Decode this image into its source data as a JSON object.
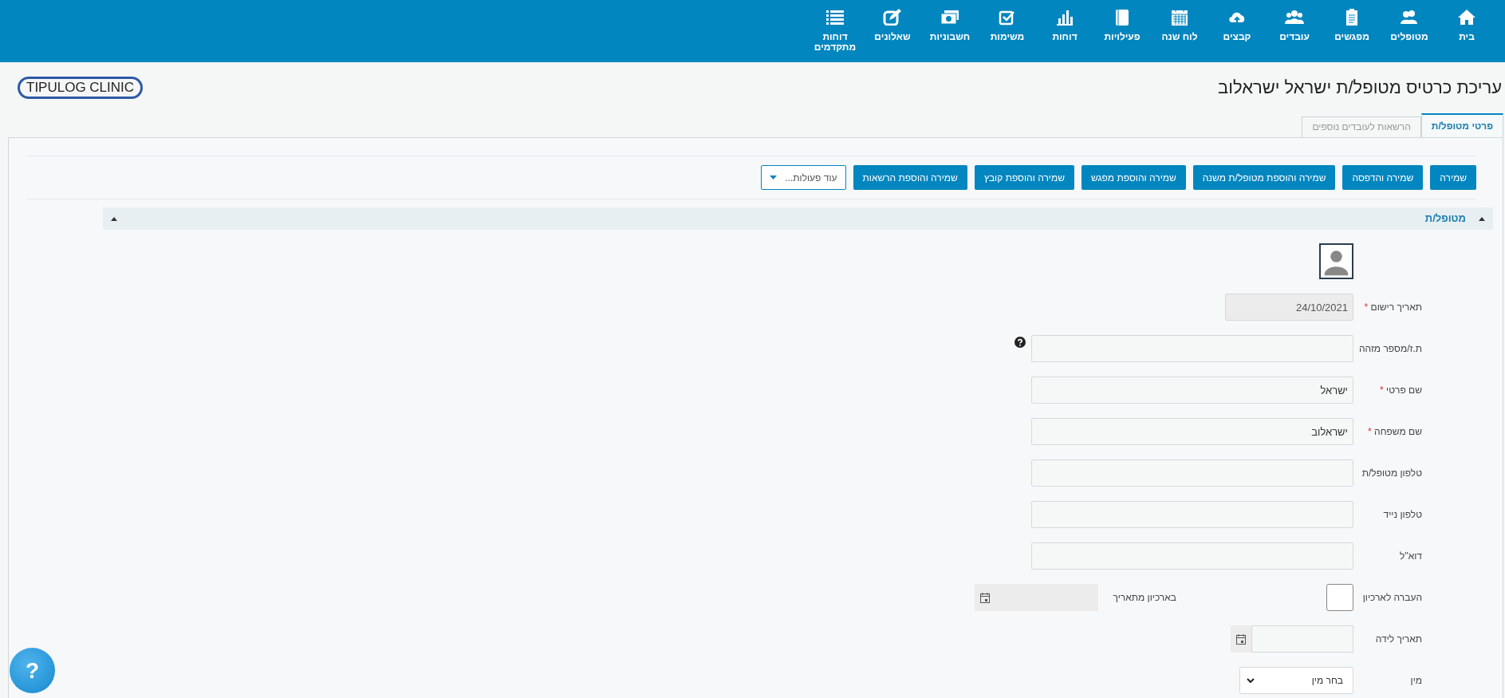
{
  "nav": [
    {
      "label": "בית"
    },
    {
      "label": "מטופלים"
    },
    {
      "label": "מפגשים"
    },
    {
      "label": "עובדים"
    },
    {
      "label": "קבצים"
    },
    {
      "label": "לוח שנה"
    },
    {
      "label": "פעילויות"
    },
    {
      "label": "דוחות"
    },
    {
      "label": "משימות"
    },
    {
      "label": "חשבוניות"
    },
    {
      "label": "שאלונים"
    },
    {
      "label": "דוחות מתקדמים"
    }
  ],
  "page_title": "עריכת כרטיס מטופל/ת ישראל ישראלוב",
  "logo": "TIPULOG CLINIC",
  "tabs": [
    {
      "label": "פרטי מטופל/ת",
      "selected": true
    },
    {
      "label": "הרשאות לעובדים נוספים",
      "selected": false
    }
  ],
  "actions": [
    {
      "label": "שמירה"
    },
    {
      "label": "שמירה והדפסה"
    },
    {
      "label": "שמירה והוספת מטופל/ת משנה"
    },
    {
      "label": "שמירה והוספת מפגש"
    },
    {
      "label": "שמירה והוספת קובץ"
    },
    {
      "label": "שמירה והוספת הרשאות"
    }
  ],
  "more_actions": {
    "label": "עוד פעולות..."
  },
  "section": {
    "title": "מטופל/ת",
    "expanded": true
  },
  "fields": [
    {
      "kind": "short_text",
      "label": "תאריך רישום",
      "marker": "*",
      "value": "24/10/2021",
      "disabled": true,
      "help": false
    },
    {
      "kind": "text",
      "label": "ת.ז/מספר מזהה",
      "disabled": false,
      "help": true
    },
    {
      "kind": "text",
      "label": "שם פרטי",
      "marker": "*",
      "value": "ישראל",
      "disabled": false,
      "help": false
    },
    {
      "kind": "text",
      "label": "שם משפחה",
      "marker": "*",
      "value": "ישראלוב",
      "disabled": false,
      "help": false
    },
    {
      "kind": "text",
      "label": "טלפון מטופל/ת",
      "disabled": false,
      "help": false
    },
    {
      "kind": "text",
      "label": "טלפון נייד",
      "disabled": false,
      "help": false
    },
    {
      "kind": "text",
      "label": "דוא\"ל",
      "disabled": false,
      "help": false
    },
    {
      "kind": "checkbox",
      "label": "העברה לארכיון",
      "checked": false,
      "date_label": "בארכיון מתאריך",
      "date_disabled": true
    },
    {
      "kind": "date",
      "label": "תאריך לידה",
      "disabled": false
    },
    {
      "kind": "select",
      "label": "מין",
      "value": "בחר מין"
    }
  ],
  "help_button": {
    "label": "?"
  }
}
